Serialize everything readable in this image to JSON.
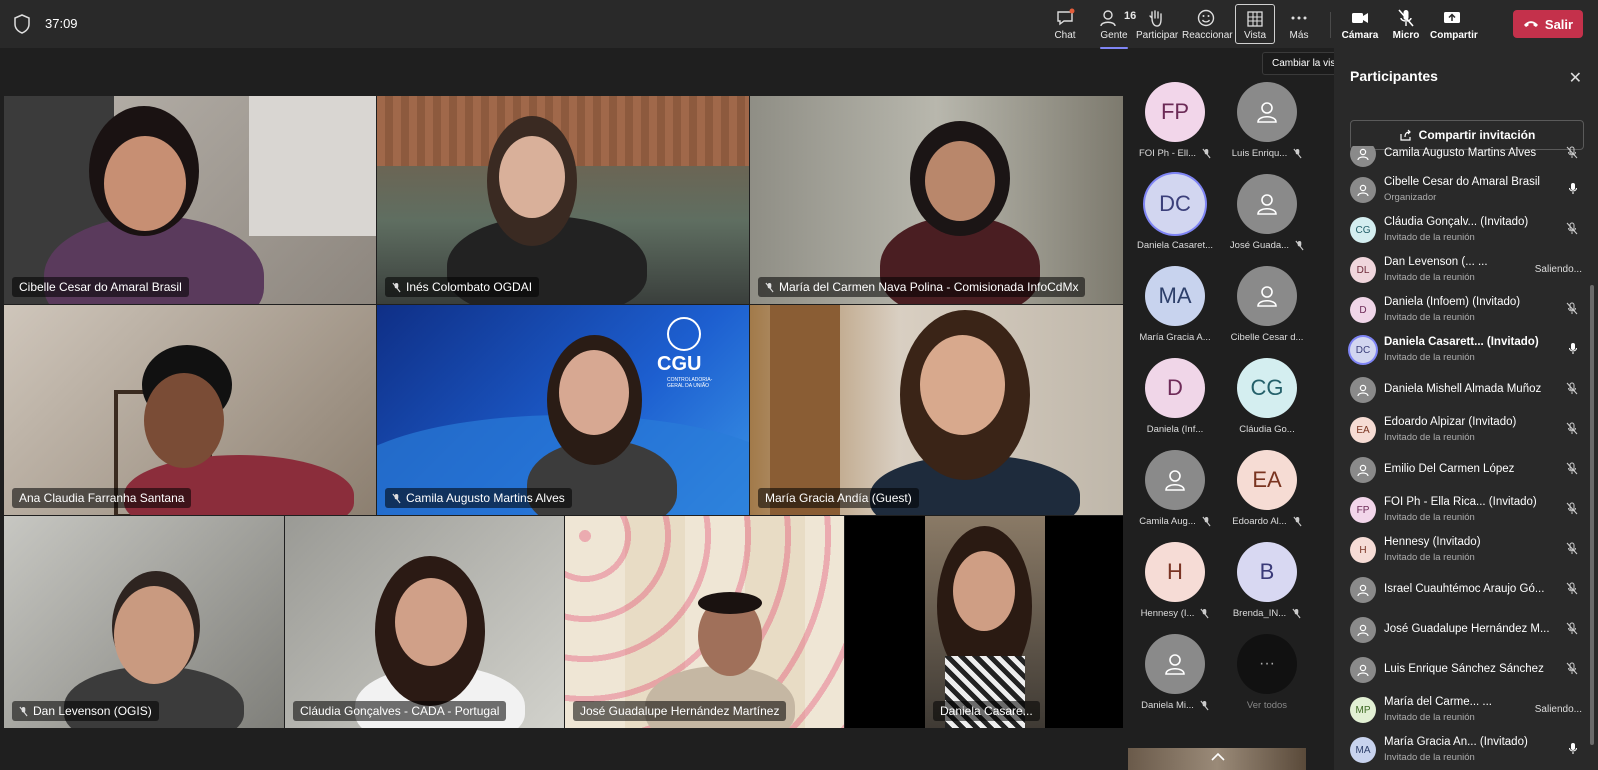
{
  "topbar": {
    "timer": "37:09",
    "chat": "Chat",
    "people_count": "16",
    "people": "Gente",
    "raise": "Participar",
    "react": "Reaccionar",
    "view": "Vista",
    "more": "Más",
    "camera": "Cámara",
    "mic": "Micro",
    "share": "Compartir",
    "leave": "Salir",
    "tooltip": "Cambiar la vista"
  },
  "tiles": [
    {
      "name": "Cibelle Cesar do Amaral Brasil"
    },
    {
      "name": "Inés Colombato OGDAI"
    },
    {
      "name": "María del Carmen Nava Polina - Comisionada InfoCdMx"
    },
    {
      "name": "Ana Claudia Farranha Santana"
    },
    {
      "name": "Camila Augusto Martins Alves"
    },
    {
      "name": "María Gracia Andía (Guest)"
    },
    {
      "name": "Dan Levenson (OGIS)"
    },
    {
      "name": "Cláudia Gonçalves - CADA - Portugal"
    },
    {
      "name": "José Guadalupe Hernández Martínez"
    },
    {
      "name": "Daniela Casare..."
    }
  ],
  "cgu": {
    "title": "CGU",
    "subtitle": "CONTROLADORIA-GERAL DA UNIÃO"
  },
  "gallery": [
    {
      "initials": "FP",
      "name": "FOI Ph - Ell..."
    },
    {
      "initials": "",
      "name": "Luis Enriqu..."
    },
    {
      "initials": "DC",
      "name": "Daniela Casaret..."
    },
    {
      "initials": "",
      "name": "José Guada..."
    },
    {
      "initials": "MA",
      "name": "María Gracia A..."
    },
    {
      "initials": "",
      "name": "Cibelle Cesar d..."
    },
    {
      "initials": "D",
      "name": "Daniela (Inf..."
    },
    {
      "initials": "CG",
      "name": "Cláudia Go..."
    },
    {
      "initials": "",
      "name": "Camila Aug..."
    },
    {
      "initials": "EA",
      "name": "Edoardo Al..."
    },
    {
      "initials": "H",
      "name": "Hennesy (I..."
    },
    {
      "initials": "B",
      "name": "Brenda_IN..."
    },
    {
      "initials": "",
      "name": "Daniela Mi..."
    },
    {
      "initials": "···",
      "name": "Ver todos"
    }
  ],
  "panel": {
    "title": "Participantes",
    "invite": "Compartir invitación",
    "people": [
      {
        "initials": "",
        "name": "Camila Augusto Martins Alves",
        "sub": "",
        "status": ""
      },
      {
        "initials": "",
        "name": "Cibelle Cesar do Amaral Brasil",
        "sub": "Organizador",
        "status": ""
      },
      {
        "initials": "CG",
        "name": "Cláudia Gonçalv...  (Invitado)",
        "sub": "Invitado de la reunión",
        "status": ""
      },
      {
        "initials": "DL",
        "name": "Dan Levenson (...          ...",
        "sub": "Invitado de la reunión",
        "status": "Saliendo..."
      },
      {
        "initials": "D",
        "name": "Daniela (Infoem) (Invitado)",
        "sub": "Invitado de la reunión",
        "status": ""
      },
      {
        "initials": "DC",
        "name": "Daniela Casarett... (Invitado)",
        "sub": "Invitado de la reunión",
        "status": ""
      },
      {
        "initials": "",
        "name": "Daniela Mishell Almada Muñoz",
        "sub": "",
        "status": ""
      },
      {
        "initials": "EA",
        "name": "Edoardo Alpizar (Invitado)",
        "sub": "Invitado de la reunión",
        "status": ""
      },
      {
        "initials": "",
        "name": "Emilio Del Carmen López",
        "sub": "",
        "status": ""
      },
      {
        "initials": "FP",
        "name": "FOI Ph - Ella Rica... (Invitado)",
        "sub": "Invitado de la reunión",
        "status": ""
      },
      {
        "initials": "H",
        "name": "Hennesy (Invitado)",
        "sub": "Invitado de la reunión",
        "status": ""
      },
      {
        "initials": "",
        "name": "Israel Cuauhtémoc Araujo Gó...",
        "sub": "",
        "status": ""
      },
      {
        "initials": "",
        "name": "José Guadalupe Hernández M...",
        "sub": "",
        "status": ""
      },
      {
        "initials": "",
        "name": "Luis Enrique Sánchez Sánchez",
        "sub": "",
        "status": ""
      },
      {
        "initials": "MP",
        "name": "María del Carme...          ...",
        "sub": "Invitado de la reunión",
        "status": "Saliendo..."
      },
      {
        "initials": "MA",
        "name": "María Gracia An...  (Invitado)",
        "sub": "Invitado de la reunión",
        "status": ""
      }
    ]
  },
  "colors": {
    "accent": "#7f85f5",
    "leave": "#c4314b",
    "bg": "#1f1f1f",
    "bar": "#292929"
  }
}
